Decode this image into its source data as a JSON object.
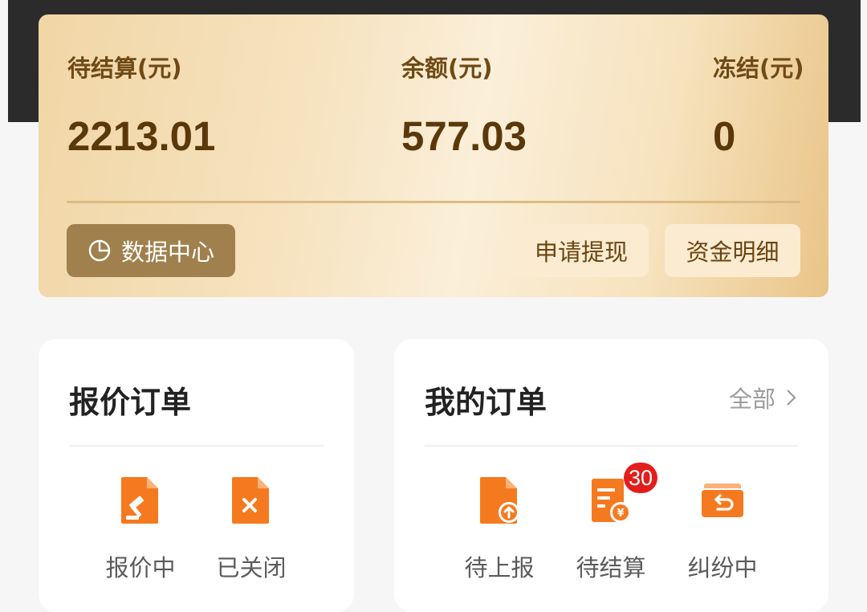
{
  "wallet": {
    "pending_label": "待结算(元)",
    "pending_value": "2213.01",
    "balance_label": "余额(元)",
    "balance_value": "577.03",
    "frozen_label": "冻结(元)",
    "frozen_value": "0",
    "data_center_label": "数据中心",
    "withdraw_label": "申请提现",
    "details_label": "资金明细"
  },
  "quote_orders": {
    "title": "报价订单",
    "items": [
      {
        "label": "报价中",
        "icon": "auction-document-icon"
      },
      {
        "label": "已关闭",
        "icon": "closed-document-icon"
      }
    ]
  },
  "my_orders": {
    "title": "我的订单",
    "all_label": "全部",
    "items": [
      {
        "label": "待上报",
        "icon": "upload-document-icon"
      },
      {
        "label": "待结算",
        "icon": "settlement-bill-icon",
        "badge": "30"
      },
      {
        "label": "纠纷中",
        "icon": "dispute-box-icon"
      }
    ]
  },
  "colors": {
    "accent_orange": "#f57a1f",
    "badge_red": "#e31d1a",
    "card_gold": "#f6e3c0",
    "data_button": "#a0804d"
  }
}
